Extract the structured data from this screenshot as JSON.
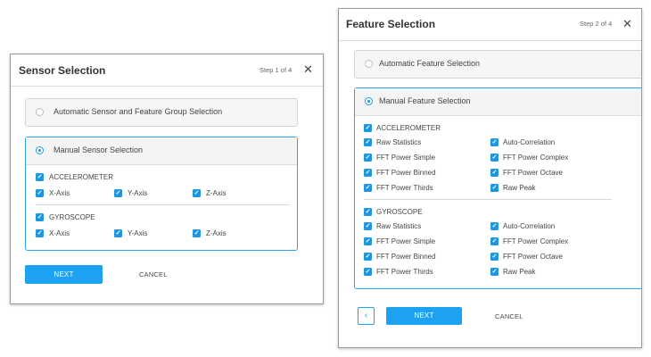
{
  "sensor_dialog": {
    "title": "Sensor Selection",
    "step": "Step 1 of 4",
    "close_icon": "close-icon",
    "auto_option": "Automatic Sensor and Feature Group Selection",
    "manual_option": "Manual Sensor Selection",
    "groups": [
      {
        "name": "ACCELEROMETER",
        "axes": [
          "X-Axis",
          "Y-Axis",
          "Z-Axis"
        ]
      },
      {
        "name": "GYROSCOPE",
        "axes": [
          "X-Axis",
          "Y-Axis",
          "Z-Axis"
        ]
      }
    ],
    "next_label": "NEXT",
    "cancel_label": "CANCEL"
  },
  "feature_dialog": {
    "title": "Feature Selection",
    "step": "Step 2 of 4",
    "close_icon": "close-icon",
    "auto_option": "Automatic Feature Selection",
    "manual_option": "Manual Feature Selection",
    "groups": [
      {
        "name": "ACCELEROMETER",
        "left": [
          "Raw Statistics",
          "FFT Power Simple",
          "FFT Power Binned",
          "FFT Power Thirds"
        ],
        "right": [
          "Auto-Correlation",
          "FFT Power Complex",
          "FFT Power Octave",
          "Raw Peak"
        ]
      },
      {
        "name": "GYROSCOPE",
        "left": [
          "Raw Statistics",
          "FFT Power Simple",
          "FFT Power Binned",
          "FFT Power Thirds"
        ],
        "right": [
          "Auto-Correlation",
          "FFT Power Complex",
          "FFT Power Octave",
          "Raw Peak"
        ]
      }
    ],
    "back_icon": "chevron-left-icon",
    "next_label": "NEXT",
    "cancel_label": "CANCEL"
  }
}
